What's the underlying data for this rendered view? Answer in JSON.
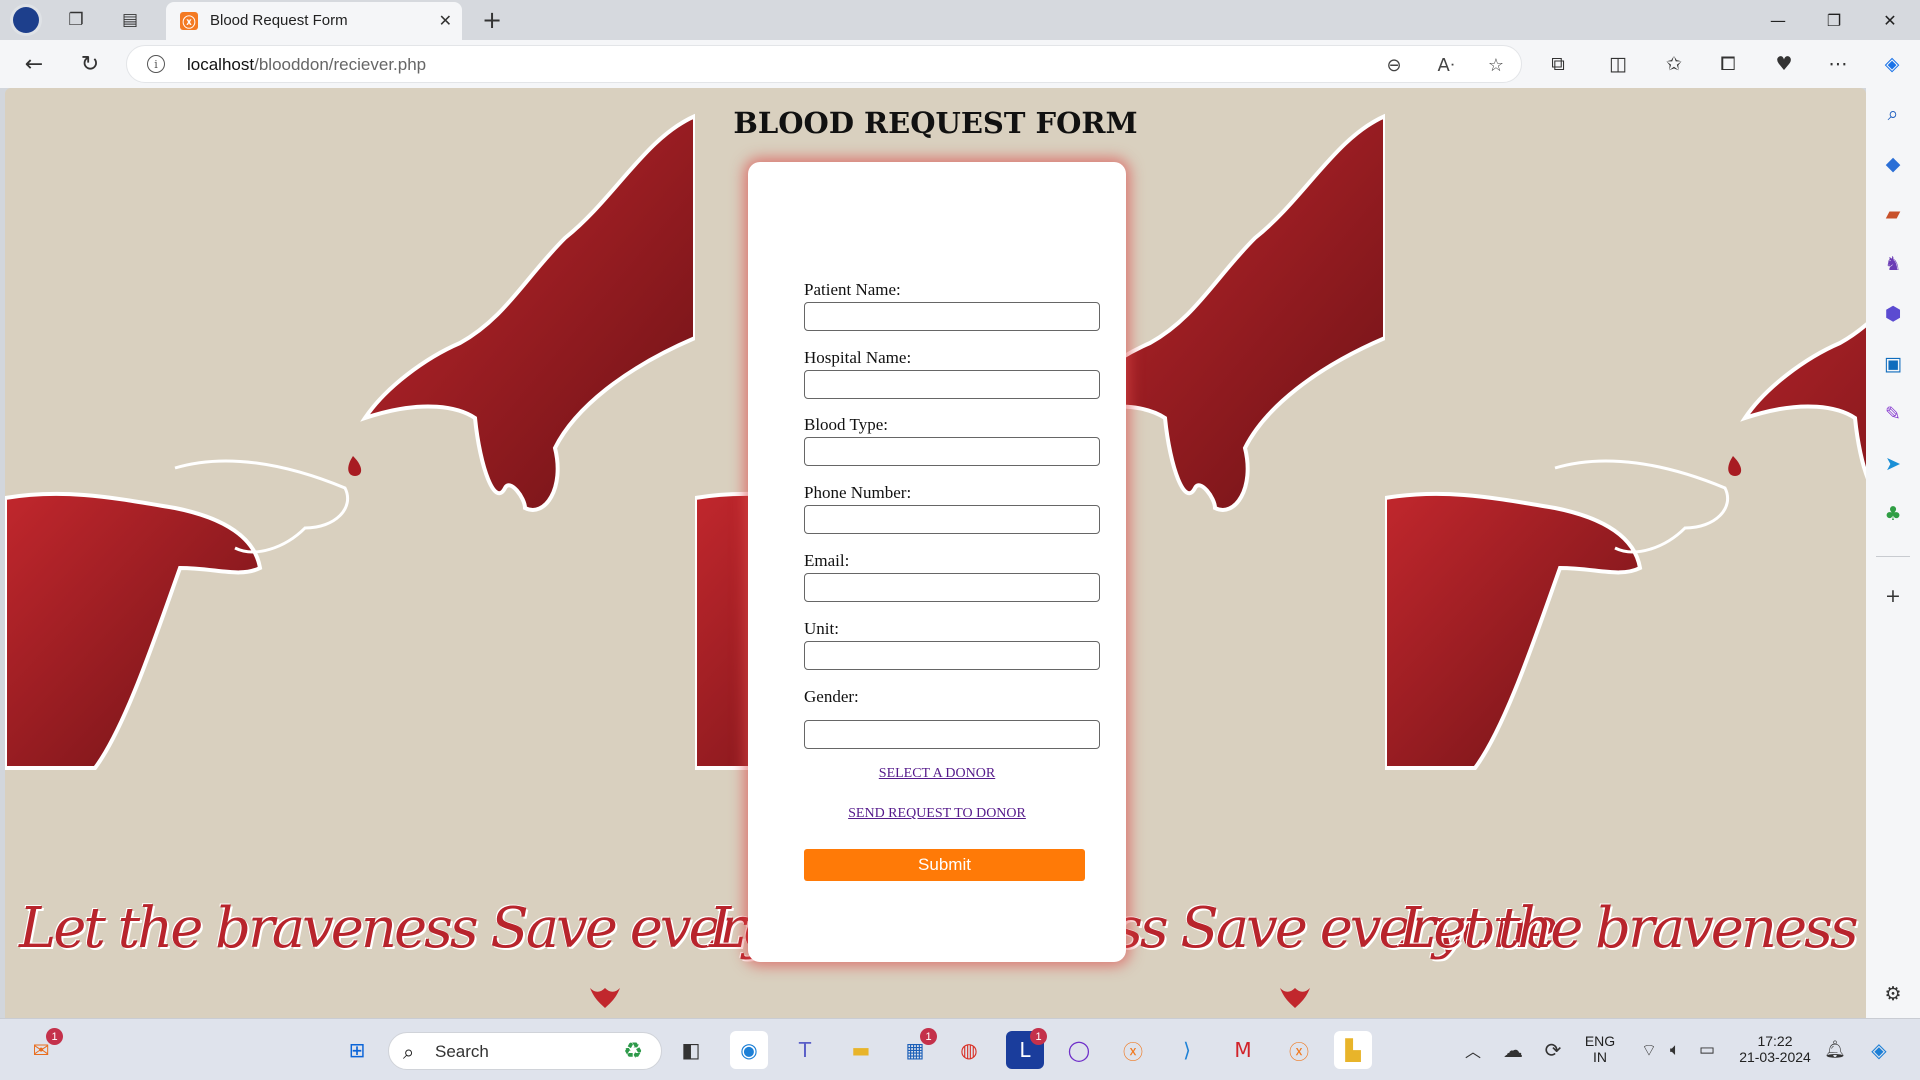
{
  "browser": {
    "tab_title": "Blood Request Form",
    "url_host": "localhost",
    "url_path": "/blooddon/reciever.php"
  },
  "page": {
    "heading": "BLOOD REQUEST FORM",
    "slogan": "Let the braveness Save everyone",
    "accent_color": "#ff7a07",
    "fields": [
      {
        "label": "Patient Name:",
        "value": ""
      },
      {
        "label": "Hospital Name:",
        "value": ""
      },
      {
        "label": "Blood Type:",
        "value": ""
      },
      {
        "label": "Phone Number:",
        "value": ""
      },
      {
        "label": "Email:",
        "value": ""
      },
      {
        "label": "Unit:",
        "value": ""
      },
      {
        "label": "Gender:",
        "value": ""
      }
    ],
    "links": {
      "select_donor": "SELECT A DONOR",
      "send_request": "SEND REQUEST TO DONOR"
    },
    "submit_label": "Submit"
  },
  "taskbar": {
    "search_placeholder": "Search",
    "badges": {
      "mail": "1",
      "store": "1",
      "l_app": "1"
    },
    "language": "ENG",
    "region": "IN",
    "time": "17:22",
    "date": "21-03-2024"
  }
}
